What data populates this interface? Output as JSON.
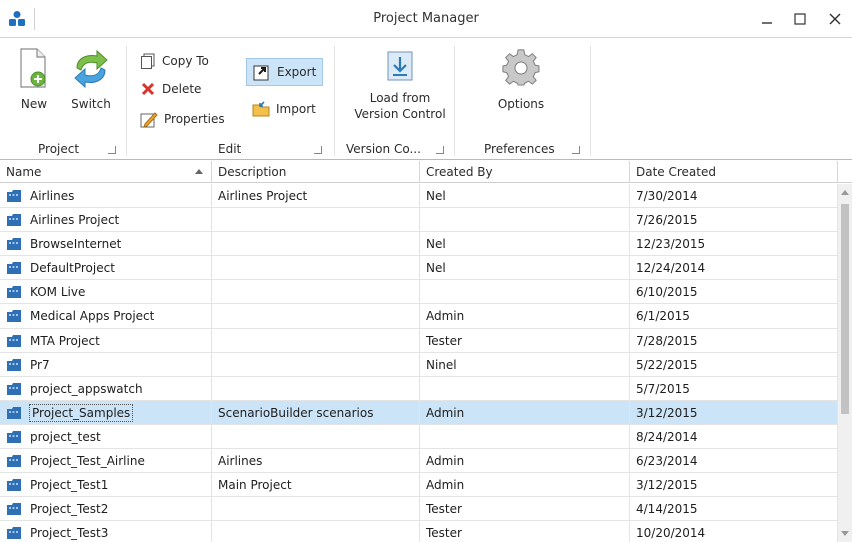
{
  "window": {
    "title": "Project Manager",
    "logo_icon": "app-logo-icon",
    "controls": [
      "minimize-icon",
      "maximize-icon",
      "close-icon"
    ]
  },
  "ribbon": {
    "groups": {
      "project": {
        "label": "Project",
        "new_label": "New",
        "switch_label": "Switch"
      },
      "edit": {
        "label": "Edit",
        "copy_to_label": "Copy To",
        "delete_label": "Delete",
        "properties_label": "Properties",
        "export_label": "Export",
        "import_label": "Import"
      },
      "version_control": {
        "label": "Version Co...",
        "load_label_1": "Load from",
        "load_label_2": "Version Control"
      },
      "preferences": {
        "label": "Preferences",
        "options_label": "Options"
      }
    },
    "accent_color": "#cce4f7"
  },
  "grid": {
    "columns": {
      "name": "Name",
      "description": "Description",
      "created_by": "Created By",
      "date_created": "Date Created"
    },
    "sorted_column": "Name",
    "sort_direction": "ascending",
    "selected_row": "Project_Samples",
    "rows": [
      {
        "name": "Airlines",
        "description": "Airlines Project",
        "created_by": "Nel",
        "date_created": "7/30/2014"
      },
      {
        "name": "Airlines Project",
        "description": "",
        "created_by": "",
        "date_created": "7/26/2015"
      },
      {
        "name": "BrowseInternet",
        "description": "",
        "created_by": "Nel",
        "date_created": "12/23/2015"
      },
      {
        "name": "DefaultProject",
        "description": "",
        "created_by": "Nel",
        "date_created": "12/24/2014"
      },
      {
        "name": "KOM Live",
        "description": "",
        "created_by": "",
        "date_created": "6/10/2015"
      },
      {
        "name": "Medical Apps Project",
        "description": "",
        "created_by": "Admin",
        "date_created": "6/1/2015"
      },
      {
        "name": "MTA Project",
        "description": "",
        "created_by": "Tester",
        "date_created": "7/28/2015"
      },
      {
        "name": "Pr7",
        "description": "",
        "created_by": "Ninel",
        "date_created": "5/22/2015"
      },
      {
        "name": "project_appswatch",
        "description": "",
        "created_by": "",
        "date_created": "5/7/2015"
      },
      {
        "name": "Project_Samples",
        "description": "ScenarioBuilder scenarios",
        "created_by": "Admin",
        "date_created": "3/12/2015"
      },
      {
        "name": "project_test",
        "description": "",
        "created_by": "",
        "date_created": "8/24/2014"
      },
      {
        "name": "Project_Test_Airline",
        "description": "Airlines",
        "created_by": "Admin",
        "date_created": "6/23/2014"
      },
      {
        "name": "Project_Test1",
        "description": "Main Project",
        "created_by": "Admin",
        "date_created": "3/12/2015"
      },
      {
        "name": "Project_Test2",
        "description": "",
        "created_by": "Tester",
        "date_created": "4/14/2015"
      },
      {
        "name": "Project_Test3",
        "description": "",
        "created_by": "Tester",
        "date_created": "10/20/2014"
      }
    ],
    "row_icon": "project-folder-icon"
  }
}
